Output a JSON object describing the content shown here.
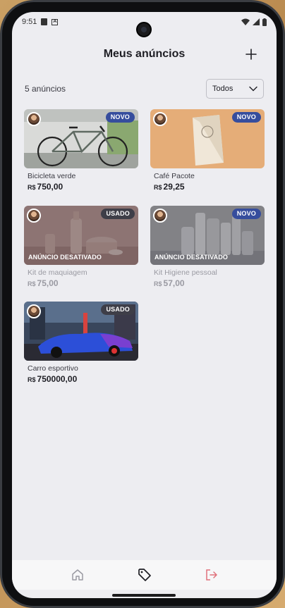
{
  "status": {
    "time": "9:51"
  },
  "header": {
    "title": "Meus anúncios"
  },
  "toolbar": {
    "count_label": "5 anúncios",
    "filter_selected": "Todos"
  },
  "currency": "R$",
  "deactivated_label": "ANÚNCIO DESATIVADO",
  "ads": [
    {
      "title": "Bicicleta verde",
      "price": "750,00",
      "badge": "NOVO",
      "badge_type": "novo",
      "active": true,
      "image": "bicycle"
    },
    {
      "title": "Café Pacote",
      "price": "29,25",
      "badge": "NOVO",
      "badge_type": "novo",
      "active": true,
      "image": "coffee-bag"
    },
    {
      "title": "Kit de maquiagem",
      "price": "75,00",
      "badge": "USADO",
      "badge_type": "usado",
      "active": false,
      "image": "makeup-kit"
    },
    {
      "title": "Kit Higiene pessoal",
      "price": "57,00",
      "badge": "NOVO",
      "badge_type": "novo",
      "active": false,
      "image": "hygiene-kit"
    },
    {
      "title": "Carro esportivo",
      "price": "750000,00",
      "badge": "USADO",
      "badge_type": "usado",
      "active": true,
      "image": "sports-car"
    }
  ],
  "nav": {
    "items": [
      "home-icon",
      "tag-icon",
      "logout-icon"
    ],
    "active": "tag-icon"
  },
  "colors": {
    "novo": "#364d9d",
    "usado": "#3e3e48",
    "logout": "#e0707a",
    "background": "#ededf1"
  }
}
